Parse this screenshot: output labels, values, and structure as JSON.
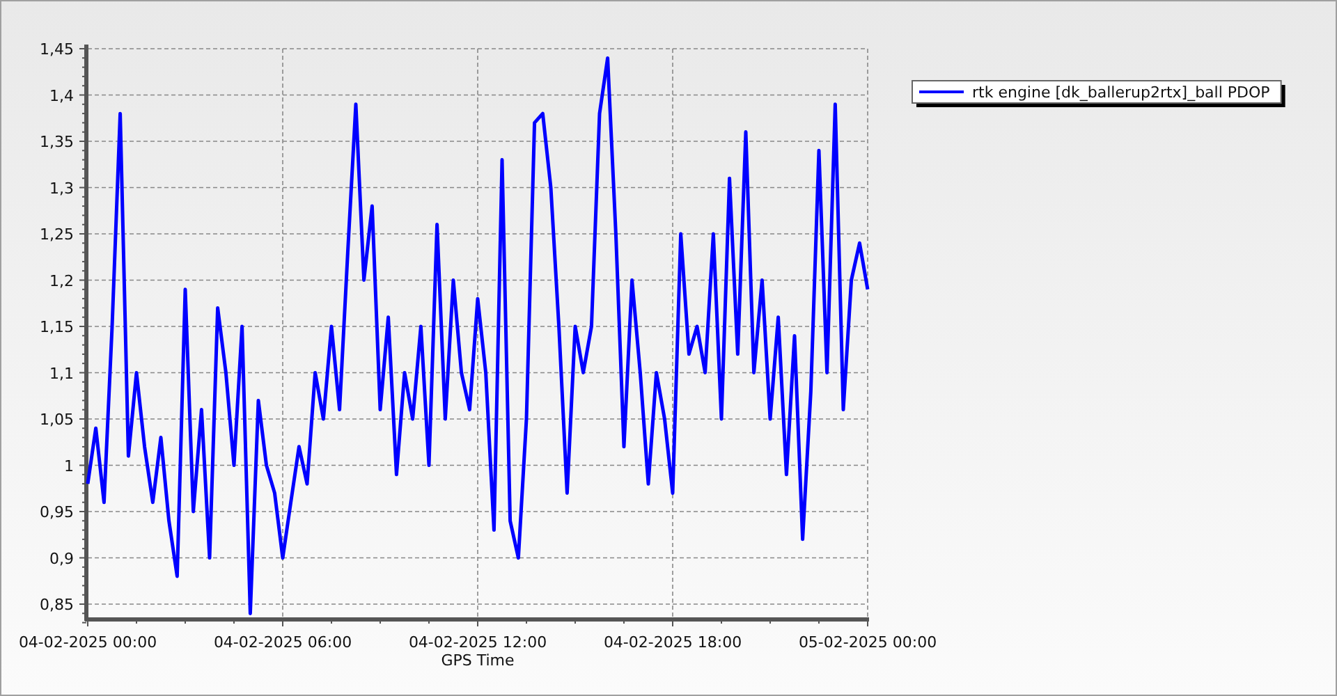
{
  "chart": {
    "chart_data": {
      "type": "line",
      "xlabel": "GPS Time",
      "categories": [
        "04-02-2025 00:00",
        null,
        null,
        null,
        null,
        null,
        null,
        null,
        null,
        null,
        null,
        null,
        null,
        null,
        null,
        null,
        null,
        null,
        null,
        null,
        null,
        null,
        null,
        null,
        "04-02-2025 06:00",
        null,
        null,
        null,
        null,
        null,
        null,
        null,
        null,
        null,
        null,
        null,
        null,
        null,
        null,
        null,
        null,
        null,
        null,
        null,
        null,
        null,
        null,
        null,
        "04-02-2025 12:00",
        null,
        null,
        null,
        null,
        null,
        null,
        null,
        null,
        null,
        null,
        null,
        null,
        null,
        null,
        null,
        null,
        null,
        null,
        null,
        null,
        null,
        null,
        null,
        "04-02-2025 18:00",
        null,
        null,
        null,
        null,
        null,
        null,
        null,
        null,
        null,
        null,
        null,
        null,
        null,
        null,
        null,
        null,
        null,
        null,
        null,
        null,
        null,
        null,
        null,
        "05-02-2025 00:00"
      ],
      "series": [
        {
          "name": "rtk engine [dk_ballerup2rtx]_ball PDOP",
          "color": "#0000ff",
          "values": [
            0.98,
            1.04,
            0.96,
            1.15,
            1.38,
            1.01,
            1.1,
            1.02,
            0.96,
            1.03,
            0.94,
            0.88,
            1.19,
            0.95,
            1.06,
            0.9,
            1.17,
            1.1,
            1.0,
            1.15,
            0.84,
            1.07,
            1.0,
            0.97,
            0.9,
            0.96,
            1.02,
            0.98,
            1.1,
            1.05,
            1.15,
            1.06,
            1.23,
            1.39,
            1.2,
            1.28,
            1.06,
            1.16,
            0.99,
            1.1,
            1.05,
            1.15,
            1.0,
            1.26,
            1.05,
            1.2,
            1.1,
            1.06,
            1.18,
            1.1,
            0.93,
            1.33,
            0.94,
            0.9,
            1.05,
            1.37,
            1.38,
            1.3,
            1.15,
            0.97,
            1.15,
            1.1,
            1.15,
            1.38,
            1.44,
            1.25,
            1.02,
            1.2,
            1.1,
            0.98,
            1.1,
            1.05,
            0.97,
            1.25,
            1.12,
            1.15,
            1.1,
            1.25,
            1.05,
            1.31,
            1.12,
            1.36,
            1.1,
            1.2,
            1.05,
            1.16,
            0.99,
            1.14,
            0.92,
            1.08,
            1.34,
            1.1,
            1.39,
            1.06,
            1.2,
            1.24,
            1.19
          ]
        }
      ],
      "ylim": [
        0.83,
        1.45
      ],
      "grid": true,
      "yticks": [
        {
          "value": 0.85,
          "label": "0,85"
        },
        {
          "value": 0.9,
          "label": "0,9"
        },
        {
          "value": 0.95,
          "label": "0,95"
        },
        {
          "value": 1,
          "label": "1"
        },
        {
          "value": 1.05,
          "label": "1,05"
        },
        {
          "value": 1.1,
          "label": "1,1"
        },
        {
          "value": 1.15,
          "label": "1,15"
        },
        {
          "value": 1.2,
          "label": "1,2"
        },
        {
          "value": 1.25,
          "label": "1,25"
        },
        {
          "value": 1.3,
          "label": "1,3"
        },
        {
          "value": 1.35,
          "label": "1,35"
        },
        {
          "value": 1.4,
          "label": "1,4"
        },
        {
          "value": 1.45,
          "label": "1,45"
        }
      ]
    }
  }
}
